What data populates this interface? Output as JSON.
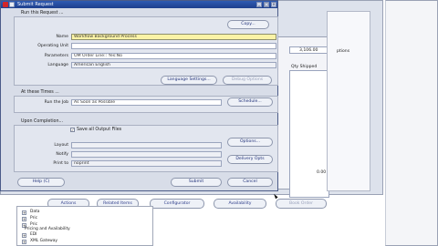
{
  "dialog": {
    "title": "Submit Request",
    "minimize": "_",
    "maximize": "□",
    "close": "×",
    "run_this_request": "Run this Request ...",
    "copy_button": "Copy...",
    "name_label": "Name",
    "name_value": "Workflow Background Process",
    "operating_unit_label": "Operating Unit",
    "operating_unit_value": "",
    "parameters_label": "Parameters",
    "parameters_value": "OM Order Line:: Yes:No",
    "language_label": "Language",
    "language_value": "American English",
    "language_settings_button": "Language Settings...",
    "debug_options_button": "Debug Options",
    "at_these_times": "At these Times ...",
    "run_the_job_label": "Run the Job",
    "run_the_job_value": "As Soon as Possible",
    "schedule_button": "Schedule...",
    "upon_completion": "Upon Completion...",
    "save_output_label": "Save all Output Files",
    "save_output_checked": "✓",
    "layout_label": "Layout",
    "layout_value": "",
    "notify_label": "Notify",
    "notify_value": "",
    "print_to_label": "Print to",
    "print_to_value": "noprint",
    "options_button": "Options...",
    "delivery_opts_button": "Delivery Opts",
    "help_button": "Help (C)",
    "submit_button": "Submit",
    "cancel_button": "Cancel"
  },
  "background": {
    "value_3106": "3,106.00",
    "options_label": "ptions",
    "qty_shipped_label": "Qty Shipped",
    "value_000": "0.00",
    "bottom_buttons": [
      "Actions",
      "Related Items",
      "Configurator",
      "Availability",
      "Book Order"
    ],
    "tree_items": [
      "Data",
      "Pric",
      "Pric",
      "Pricing and Availability",
      "EDI",
      "XML Gateway"
    ]
  }
}
